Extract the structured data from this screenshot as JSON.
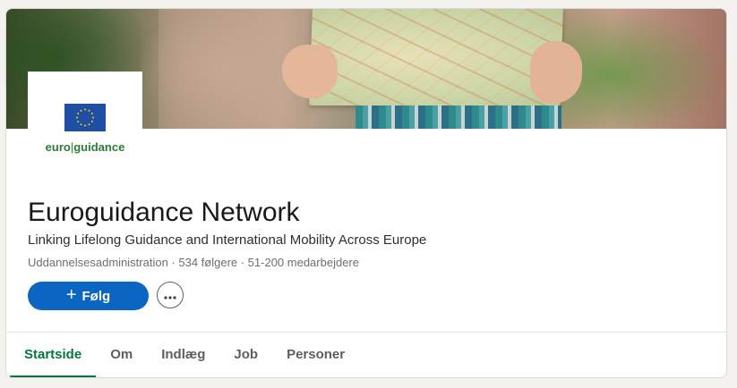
{
  "company": {
    "name": "Euroguidance Network",
    "tagline": "Linking Lifelong Guidance and International Mobility Across Europe",
    "meta": "Uddannelsesadministration · 534 følgere · 51-200 medarbejdere",
    "logo_text_left": "euro",
    "logo_text_sep": "|",
    "logo_text_right": "guidance"
  },
  "actions": {
    "follow_label": "Følg",
    "follow_icon": "plus-icon",
    "more_icon": "ellipsis-icon"
  },
  "tabs": [
    {
      "label": "Startside",
      "active": true
    },
    {
      "label": "Om",
      "active": false
    },
    {
      "label": "Indlæg",
      "active": false
    },
    {
      "label": "Job",
      "active": false
    },
    {
      "label": "Personer",
      "active": false
    }
  ],
  "colors": {
    "primary": "#0a66c2",
    "active_tab": "#057642",
    "logo_green": "#2f7a3b",
    "eu_blue": "#1f4fa5"
  }
}
